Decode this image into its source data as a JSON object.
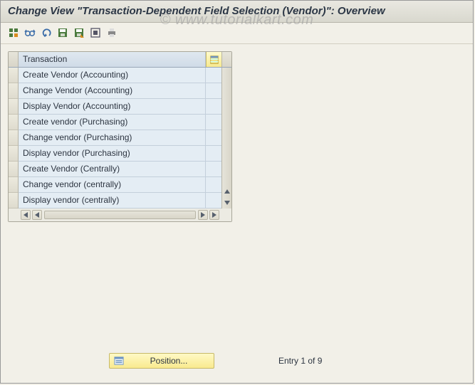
{
  "watermark": "© www.tutorialkart.com",
  "titlebar": {
    "title": "Change View \"Transaction-Dependent Field Selection (Vendor)\": Overview"
  },
  "toolbar": {
    "icons": [
      "tool-details-icon",
      "tool-glasses-icon",
      "tool-undo-icon",
      "tool-save-icon",
      "tool-save2-icon",
      "tool-selectall-icon",
      "tool-print-icon"
    ]
  },
  "table": {
    "column_header": "Transaction",
    "rows": [
      "Create Vendor (Accounting)",
      "Change Vendor (Accounting)",
      "Display Vendor (Accounting)",
      "Create vendor (Purchasing)",
      "Change vendor (Purchasing)",
      "Display vendor (Purchasing)",
      "Create Vendor (Centrally)",
      "Change vendor (centrally)",
      "Display vendor (centrally)"
    ]
  },
  "footer": {
    "position_button_label": "Position...",
    "entry_status": "Entry 1 of 9"
  },
  "chart_data": {
    "type": "table",
    "title": "Transaction-Dependent Field Selection (Vendor)",
    "categories": [
      "Transaction"
    ],
    "values": [
      [
        "Create Vendor (Accounting)"
      ],
      [
        "Change Vendor (Accounting)"
      ],
      [
        "Display Vendor (Accounting)"
      ],
      [
        "Create vendor (Purchasing)"
      ],
      [
        "Change vendor (Purchasing)"
      ],
      [
        "Display vendor (Purchasing)"
      ],
      [
        "Create Vendor (Centrally)"
      ],
      [
        "Change vendor (centrally)"
      ],
      [
        "Display vendor (centrally)"
      ]
    ]
  }
}
